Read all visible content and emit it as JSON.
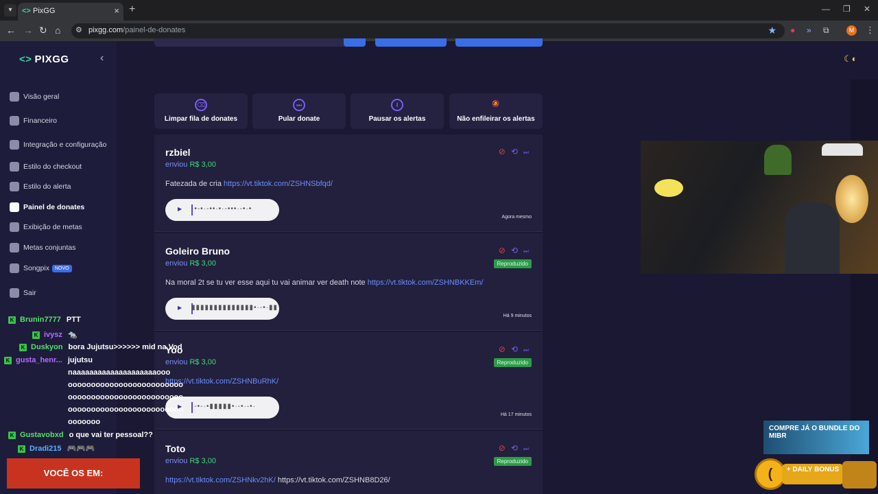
{
  "browser": {
    "tab_title": "PixGG",
    "favicon": "<>",
    "url_host": "pixgg.com",
    "url_path": "/painel-de-donates"
  },
  "sidebar": {
    "logo": "PIXGG",
    "items": [
      {
        "label": "Visão geral",
        "icon": "home-icon"
      },
      {
        "label": "Financeiro",
        "icon": "wallet-icon"
      },
      {
        "label": "Integração e configuração",
        "icon": "settings-icon"
      },
      {
        "label": "Estilo do checkout",
        "icon": "palette-icon"
      },
      {
        "label": "Estilo do alerta",
        "icon": "palette-icon"
      },
      {
        "label": "Painel de donates",
        "icon": "thumb-icon",
        "active": true
      },
      {
        "label": "Exibição de metas",
        "icon": "star-icon"
      },
      {
        "label": "Metas conjuntas",
        "icon": "rocket-icon"
      },
      {
        "label": "Songpix",
        "icon": "music-icon",
        "badge": "NOVO"
      },
      {
        "label": "Sair",
        "icon": "logout-icon"
      }
    ]
  },
  "actions": [
    {
      "label": "Limpar fila de donates",
      "icon": "eraser-icon"
    },
    {
      "label": "Pular donate",
      "icon": "skip-icon"
    },
    {
      "label": "Pausar os alertas",
      "icon": "pause-icon"
    },
    {
      "label": "Não enfileirar os alertas",
      "icon": "bell-off-icon"
    }
  ],
  "donations": [
    {
      "name": "rzbiel",
      "sent_prefix": "enviou",
      "amount": "R$ 3,00",
      "message": "Fatezada de cria",
      "links": [
        "https://vt.tiktok.com/ZSHNSbfqd/"
      ],
      "status": "",
      "time": "Agora mesmo",
      "wave": "·•-•·-••·•·-•••·-•·•"
    },
    {
      "name": "Goleiro Bruno",
      "sent_prefix": "enviou",
      "amount": "R$ 3,00",
      "message": "Na moral 2t se tu ver esse aqui tu vai animar ver death note",
      "links": [
        "https://vt.tiktok.com/ZSHNBKKEm/"
      ],
      "status": "Reproduzido",
      "time": "Há 9 minutos",
      "wave": "▮▮▮▮▮▮▮▮▮▮▮▮▮▮•·-•·▮▮"
    },
    {
      "name": "Yoo",
      "sent_prefix": "enviou",
      "amount": "R$ 3,00",
      "message": "",
      "links": [
        "https://vt.tiktok.com/ZSHNBuRhK/"
      ],
      "status": "Reproduzido",
      "time": "Há 17 minutos",
      "wave": "·-•-·•▮▮▮▮▮•·-•·-•·"
    },
    {
      "name": "Toto",
      "sent_prefix": "enviou",
      "amount": "R$ 3,00",
      "message": "",
      "links": [
        "https://vt.tiktok.com/ZSHNkv2hK/",
        "https://vt.tiktok.com/ZSHNB8D26/"
      ],
      "status": "Reproduzido",
      "time": "",
      "wave": ""
    }
  ],
  "chat": [
    {
      "user": "Brunin7777",
      "msg": "PTT",
      "color": "green",
      "badge": true
    },
    {
      "user": "ivysz",
      "msg": "🐀",
      "color": "purple",
      "badge": true
    },
    {
      "user": "Duskyon",
      "msg": "bora Jujutsu>>>>>> mid na Vod",
      "color": "green",
      "badge": true
    },
    {
      "user": "gusta_henr...",
      "msg": "jujutsu",
      "color": "purple",
      "badge": true
    },
    {
      "user": "",
      "msg": "naaaaaaaaaaaaaaaaaaaaooo"
    },
    {
      "user": "",
      "msg": "ooooooooooooooooooooooooo"
    },
    {
      "user": "",
      "msg": "ooooooooooooooooooooooooo"
    },
    {
      "user": "",
      "msg": "ooooooooooooooooooooooooo"
    },
    {
      "user": "",
      "msg": "ooooooo"
    },
    {
      "user": "Gustavobxd",
      "msg": "o que vai ter pessoal??",
      "color": "green",
      "badge": true
    },
    {
      "user": "Dradi215",
      "msg": "🎮🎮🎮",
      "color": "blue",
      "badge": true
    }
  ],
  "overlays": {
    "banner": "VOCÊ    OS EM:",
    "mibr_ad": "COMPRE JÁ O BUNDLE DO MIBR",
    "daily_bonus": "+ DAILY BONUS"
  }
}
